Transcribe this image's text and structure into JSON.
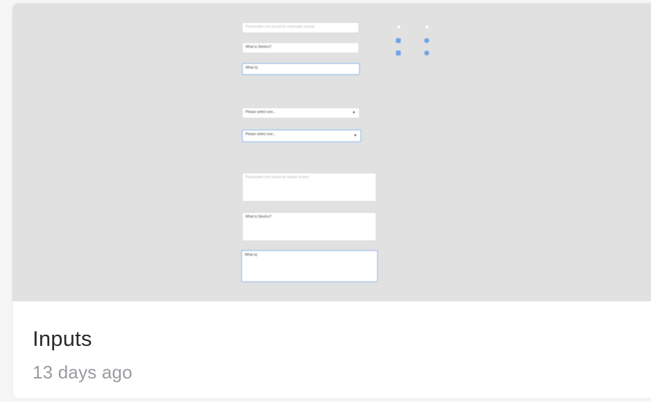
{
  "card": {
    "title": "Inputs",
    "modified": "13 days ago"
  },
  "preview": {
    "text_inputs": [
      {
        "state": "placeholder",
        "text": "Placeholder text should be noticeable at best"
      },
      {
        "state": "filled",
        "text": "What is Steelco?"
      },
      {
        "state": "focused",
        "text": "What is|"
      }
    ],
    "selects": [
      {
        "state": "default",
        "text": "Please select one..."
      },
      {
        "state": "focused",
        "text": "Please select one..."
      }
    ],
    "textareas": [
      {
        "state": "placeholder",
        "text": "Placeholder text should be legible at best"
      },
      {
        "state": "filled",
        "text": "What is Steelco?"
      },
      {
        "state": "focused",
        "text": "What is|"
      }
    ]
  },
  "colors": {
    "preview_bg": "#e1e1e1",
    "accent": "#6ea4e6",
    "title": "#2a2a2c",
    "muted": "#9a9aa0"
  }
}
